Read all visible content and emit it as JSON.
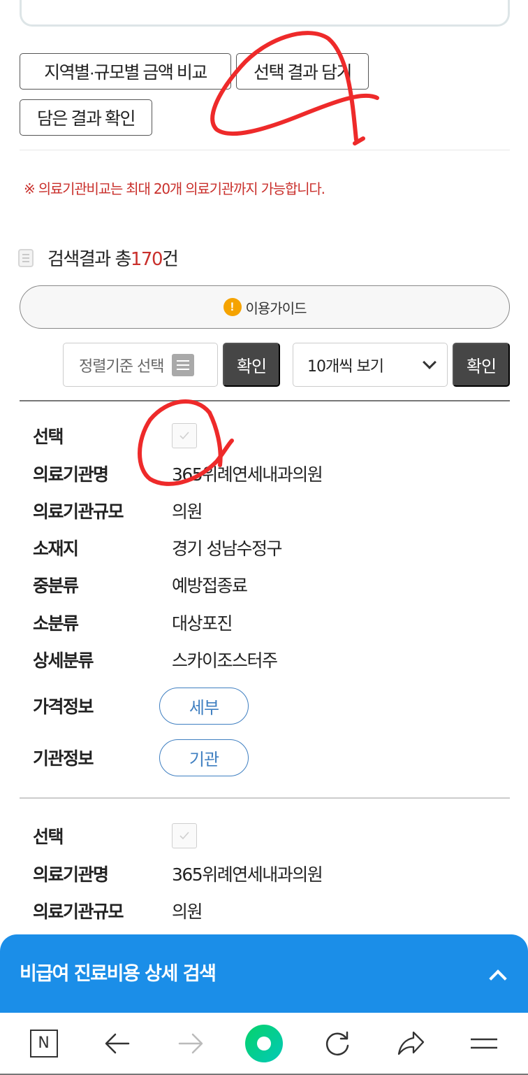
{
  "top_buttons": {
    "compare_label": "지역별·규모별 금액 비교",
    "add_selection_label": "선택 결과 담기",
    "view_saved_label": "담은 결과 확인"
  },
  "notice": "※ 의료기관비교는 최대 20개 의료기관까지 가능합니다.",
  "results": {
    "prefix": "검색결과 총",
    "count": "170",
    "suffix": "건"
  },
  "guide_button_label": "이용가이드",
  "controls": {
    "sort_placeholder": "정렬기준 선택",
    "sort_confirm_label": "확인",
    "page_size_value": "10개씩 보기",
    "page_size_confirm_label": "확인"
  },
  "result_items": [
    {
      "select_label": "선택",
      "checked": false,
      "fields": [
        {
          "label": "의료기관명",
          "value": "365위례연세내과의원"
        },
        {
          "label": "의료기관규모",
          "value": "의원"
        },
        {
          "label": "소재지",
          "value": "경기 성남수정구"
        },
        {
          "label": "중분류",
          "value": "예방접종료"
        },
        {
          "label": "소분류",
          "value": "대상포진"
        },
        {
          "label": "상세분류",
          "value": "스카이조스터주"
        }
      ],
      "price_info_label": "가격정보",
      "price_info_button": "세부",
      "institution_info_label": "기관정보",
      "institution_info_button": "기관"
    },
    {
      "select_label": "선택",
      "checked": false,
      "fields": [
        {
          "label": "의료기관명",
          "value": "365위례연세내과의원"
        },
        {
          "label": "의료기관규모",
          "value": "의원"
        }
      ]
    }
  ],
  "bottom_panel": {
    "title": "비급여 진료비용 상세 검색"
  },
  "browser_nav": {
    "items": [
      "naver-home",
      "back",
      "forward",
      "green-dot-home",
      "reload",
      "share",
      "menu"
    ],
    "home_letter": "N"
  },
  "colors": {
    "accent_red": "#c9302c",
    "accent_blue": "#1b8ee8",
    "pill_blue": "#3f7fc1",
    "dark_button": "#464646",
    "warning_orange": "#f5a300",
    "annotation_red": "#ee2a2a"
  }
}
